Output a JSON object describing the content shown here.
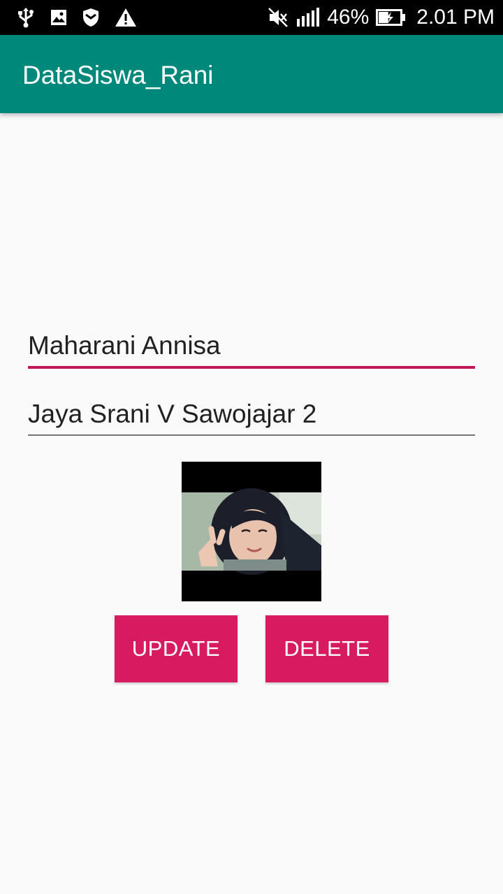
{
  "status_bar": {
    "battery_percent": "46%",
    "time": "2.01 PM",
    "battery_level": 0.46,
    "icons_left": [
      "usb-icon",
      "image-icon",
      "shield-icon",
      "warning-icon"
    ],
    "icons_right": [
      "mute-icon",
      "signal-icon",
      "battery-charging-icon"
    ]
  },
  "app_bar": {
    "title": "DataSiswa_Rani",
    "color": "#00897b"
  },
  "form": {
    "name_value": "Maharani Annisa",
    "address_value": "Jaya Srani V Sawojajar 2",
    "accent_color": "#c2185b"
  },
  "photo": {
    "description_icon": "student-photo"
  },
  "buttons": {
    "update_label": "UPDATE",
    "delete_label": "DELETE",
    "color": "#d81b60"
  }
}
